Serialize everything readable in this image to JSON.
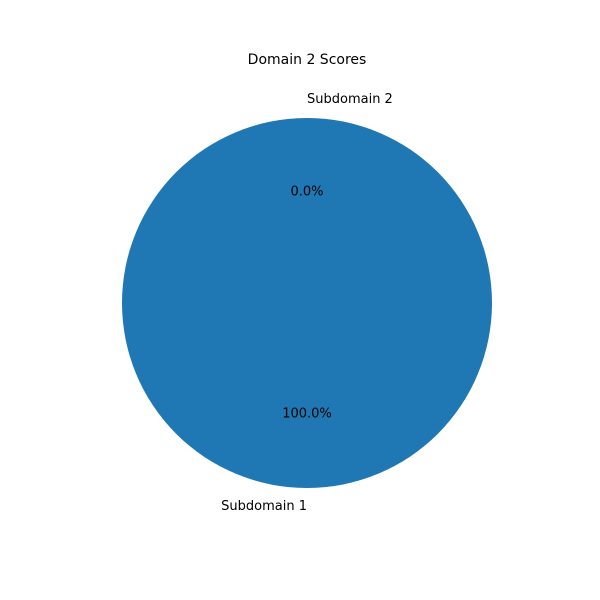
{
  "chart_data": {
    "type": "pie",
    "title": "Domain 2 Scores",
    "categories": [
      "Subdomain 1",
      "Subdomain 2"
    ],
    "values": [
      100,
      0
    ],
    "percent_labels": [
      "100.0%",
      "0.0%"
    ],
    "colors": [
      "#1f77b4",
      "#ff7f0e"
    ],
    "start_angle_deg": 90,
    "direction": "counterclockwise",
    "legend": "none"
  }
}
